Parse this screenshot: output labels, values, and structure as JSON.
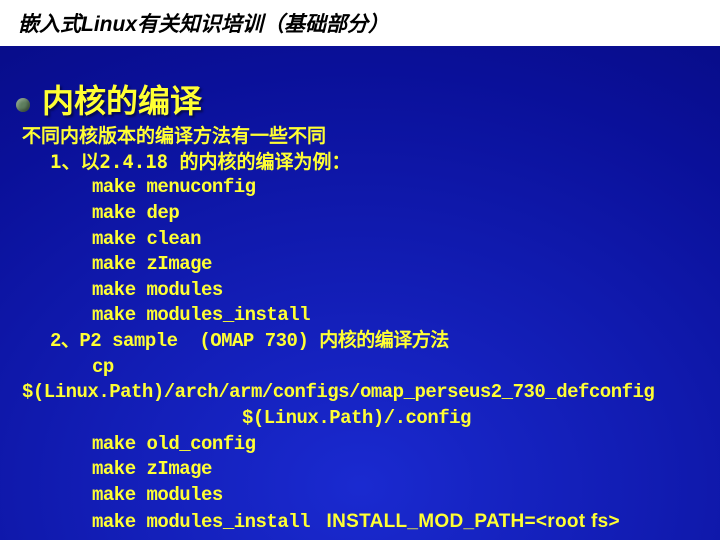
{
  "header": {
    "title": "嵌入式Linux有关知识培训（基础部分）"
  },
  "slide": {
    "title": "内核的编译",
    "intro": "不同内核版本的编译方法有一些不同",
    "sect1_label": "1、以2.4.18 的内核的编译为例：",
    "cmds1": {
      "l1": "make menuconfig",
      "l2": "make dep",
      "l3": "make clean",
      "l4": "make zImage",
      "l5": "make modules",
      "l6": "make modules_install"
    },
    "sect2_label": "2、P2 sample  (OMAP 730) 内核的编译方法",
    "sect2_cp": "cp",
    "sect2_path1": "$(Linux.Path)/arch/arm/configs/omap_perseus2_730_defconfig",
    "sect2_path2": "$(Linux.Path)/.config",
    "cmds2": {
      "l1": "make old_config",
      "l2": "make zImage",
      "l3": "make modules",
      "l4": "make modules_install ",
      "tail": " INSTALL_MOD_PATH=<root fs>"
    }
  }
}
